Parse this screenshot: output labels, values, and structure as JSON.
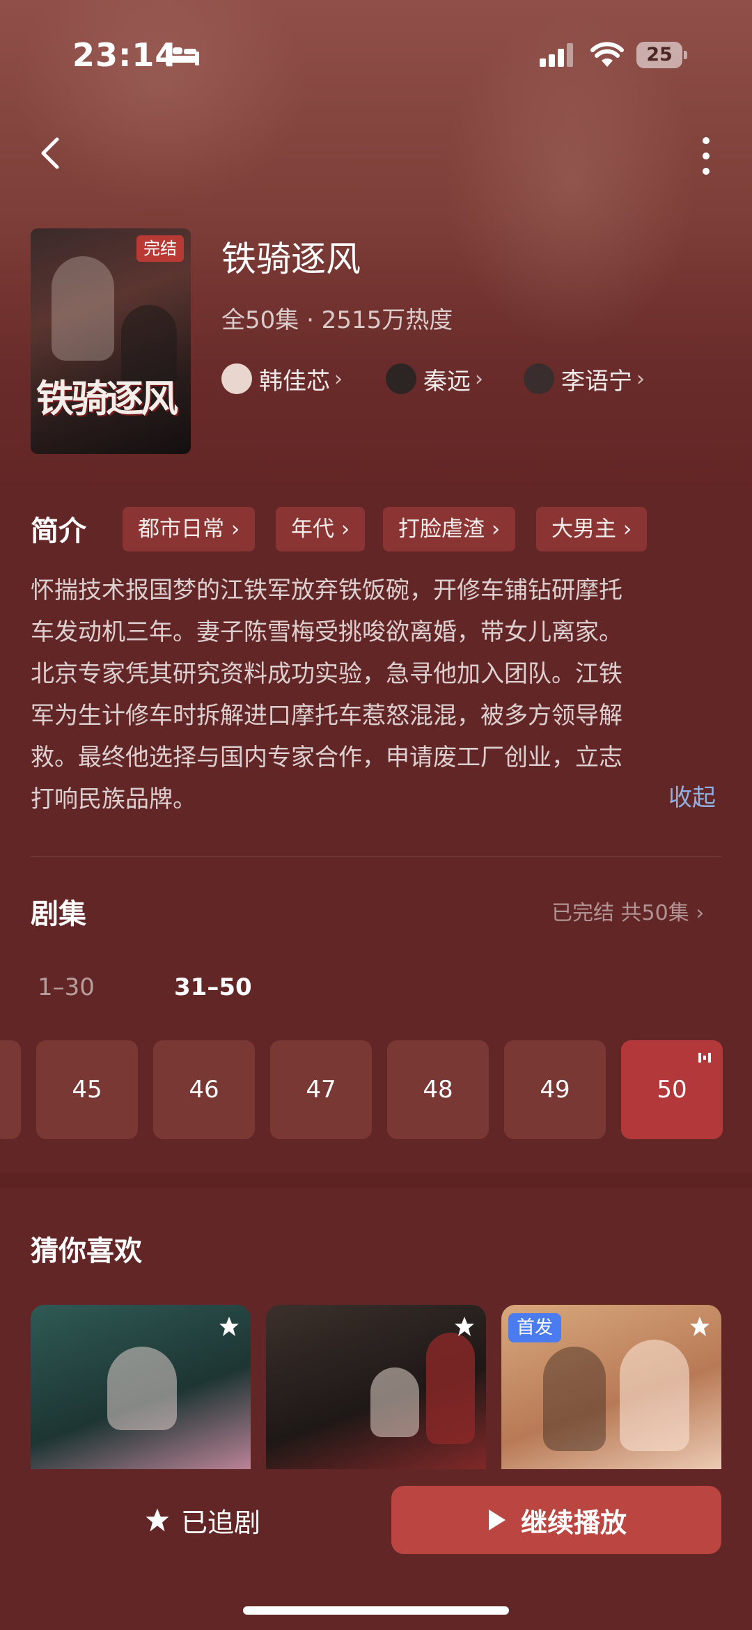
{
  "status_bar": {
    "time": "23:14",
    "battery": "25"
  },
  "show": {
    "title": "铁骑逐风",
    "poster_title": "铁骑逐风",
    "poster_badge": "完结",
    "meta": "全50集 · 2515万热度",
    "cast": [
      {
        "name": "韩佳芯",
        "avatar_color": "#e8d6cf"
      },
      {
        "name": "秦远",
        "avatar_color": "#2d2424"
      },
      {
        "name": "李语宁",
        "avatar_color": "#3a2d2d"
      }
    ]
  },
  "synopsis": {
    "label": "简介",
    "tags": [
      "都市日常",
      "年代",
      "打脸虐渣",
      "大男主"
    ],
    "lines": [
      "怀揣技术报国梦的江铁军放弃铁饭碗，开修车铺钻研摩托",
      "车发动机三年。妻子陈雪梅受挑唆欲离婚，带女儿离家。",
      "北京专家凭其研究资料成功实验，急寻他加入团队。江铁",
      "军为生计修车时拆解进口摩托车惹怒混混，被多方领导解",
      "救。最终他选择与国内专家合作，申请废工厂创业，立志",
      "打响民族品牌。"
    ],
    "collapse_label": "收起"
  },
  "episodes": {
    "label": "剧集",
    "status": "已完结 共50集",
    "ranges": [
      "1–30",
      "31–50"
    ],
    "selected_range": "31–50",
    "items": [
      "45",
      "46",
      "47",
      "48",
      "49",
      "50"
    ],
    "current": "50"
  },
  "recommend": {
    "label": "猜你喜欢",
    "items": [
      {
        "badge": "",
        "colors": [
          "#2f5a55",
          "#1d3533",
          "#c98aa0"
        ]
      },
      {
        "badge": "",
        "colors": [
          "#3b302c",
          "#1e1816",
          "#8a2a2a"
        ]
      },
      {
        "badge": "首发",
        "colors": [
          "#d8a87c",
          "#b87a56",
          "#f0d2bc"
        ]
      }
    ]
  },
  "bottom": {
    "follow_label": "已追剧",
    "play_label": "继续播放"
  },
  "colors": {
    "background": "#632626",
    "accent": "#bb4540",
    "tag_bg": "#8a3533",
    "link": "#8fb0e0"
  }
}
